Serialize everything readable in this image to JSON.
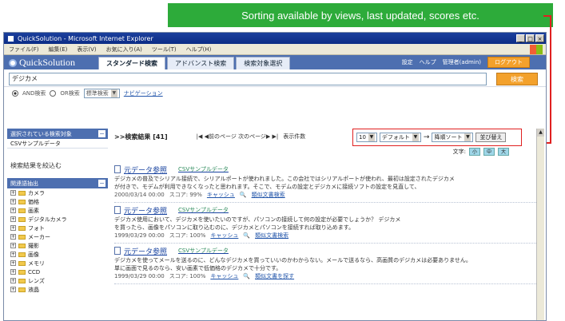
{
  "callout": {
    "text": "Sorting available by views, last updated, scores etc."
  },
  "window": {
    "title": "QuickSolution - Microsoft Internet Explorer",
    "menu": [
      "ファイル(F)",
      "編集(E)",
      "表示(V)",
      "お気に入り(A)",
      "ツール(T)",
      "ヘルプ(H)"
    ]
  },
  "header": {
    "logo": "QuickSolution",
    "tabs": [
      {
        "label": "スタンダード検索"
      },
      {
        "label": "アドバンスト検索"
      },
      {
        "label": "検索対象選択"
      }
    ],
    "settings": "設定",
    "help": "ヘルプ",
    "user": "管理者(admin)",
    "logout": "ログアウト"
  },
  "search": {
    "value": "デジカメ",
    "button": "検索",
    "mode_and": "AND検索",
    "mode_or": "OR検索",
    "type": "標準検索",
    "navi": "ナビゲーション"
  },
  "sidebar": {
    "selected_title": "選択されている検索対象",
    "selected_item": "CSVサンプルデータ",
    "narrow_title": "検索結果を絞込む",
    "tree_title": "関連語抽出",
    "tree_items": [
      "カメラ",
      "価格",
      "画素",
      "デジタルカメラ",
      "フォト",
      "メーカー",
      "撮影",
      "画像",
      "メモリ",
      "CCD",
      "レンズ",
      "液晶"
    ]
  },
  "results_bar": {
    "header": ">>検索結果 [41]",
    "pager": "|◀ ◀前のページ 次のページ▶ ▶|",
    "per_page_label": "表示件数",
    "per_page": "10",
    "sort_key": "デフォルト",
    "sort_order": "降順ソート",
    "sort_button": "並び替え",
    "font_label": "文字:",
    "font_sizes": [
      "小",
      "中",
      "大"
    ]
  },
  "results": [
    {
      "title": "元データ参照",
      "category": "CSVサンプルデータ",
      "snippet1": "デジカメの普及でシリアル接続で、シリアルポートが使われました。この会社ではシリアルポートが使われ、最初は設定されたデジカメ",
      "snippet2": "が付きで、モデムが利用できなくなったと思われます。そこで、モデムの設定とデジカメに接続ソフトの設定を見直して、",
      "date": "2000/03/14 00:00",
      "score": "スコア: 99%",
      "cache": "キャッシュ",
      "similar": "類似文書検索"
    },
    {
      "title": "元データ参照",
      "category": "CSVサンプルデータ",
      "snippet1": "デジカメ使用において、デジカメを使いたいのですが、パソコンの接続して何の設定が必要でしょうか？ デジカメ",
      "snippet2": "を買ったら、画像をパソコンに取り込むのに、デジカメとパソコンを接続すれば取り込めます。",
      "date": "1999/03/29 00:00",
      "score": "スコア: 100%",
      "cache": "キャッシュ",
      "similar": "類似文書検索"
    },
    {
      "title": "元データ参照",
      "category": "CSVサンプルデータ",
      "snippet1": "デジカメを使ってメールを送るのに、どんなデジカメを買っていいのかわからない。メールで送るなら、高画質のデジカメは必要ありません。",
      "snippet2": "単に画面で見るのなら、安い画素で低価格のデジカメで十分です。",
      "date": "1999/03/29 00:00",
      "score": "スコア: 100%",
      "cache": "キャッシュ",
      "similar": "類似文書を探す"
    }
  ],
  "colors": {
    "callout": "#2dab3a",
    "header": "#4d6fb0",
    "highlight": "#e02020",
    "button": "#f3a12c"
  }
}
